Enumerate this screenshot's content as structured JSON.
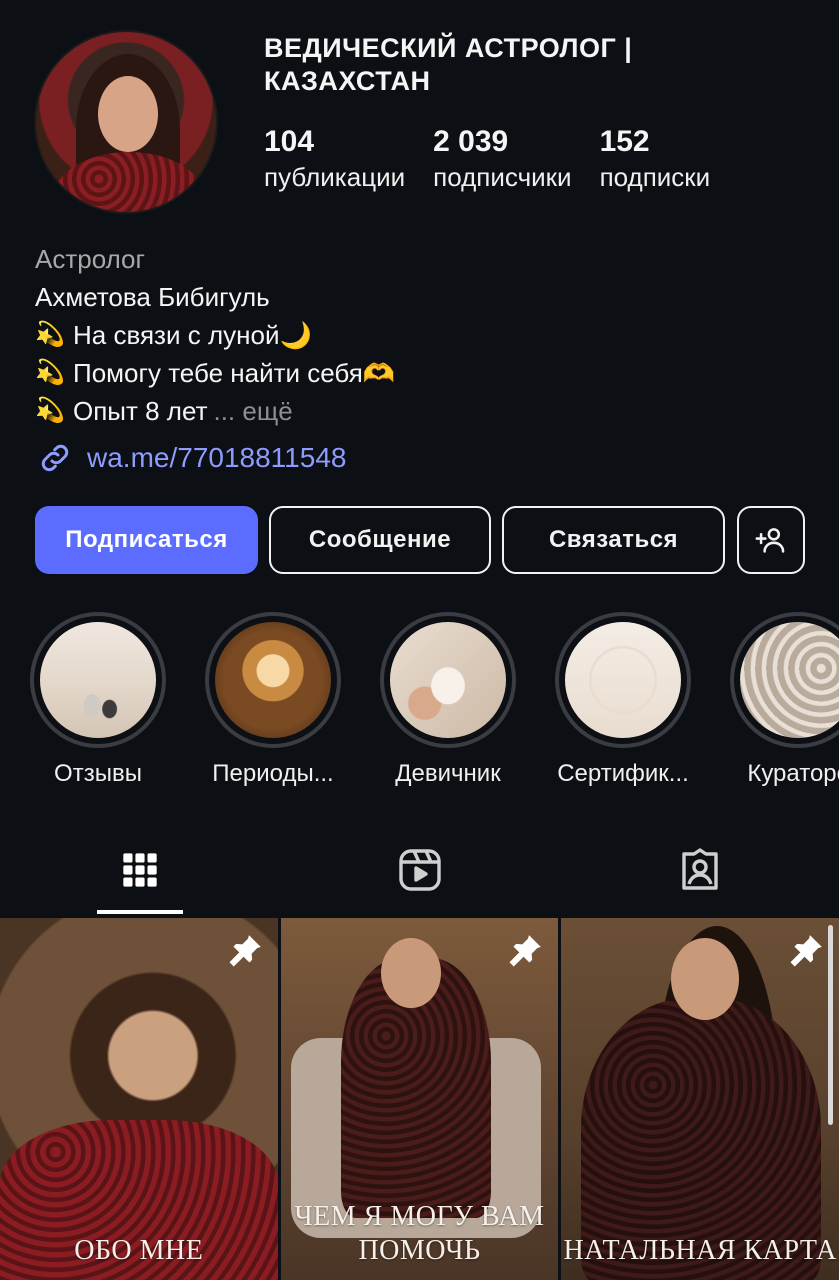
{
  "profile": {
    "title": "ВЕДИЧЕСКИЙ АСТРОЛОГ | КАЗАХСТАН",
    "stats": [
      {
        "num": "104",
        "label": "публикации"
      },
      {
        "num": "2 039",
        "label": "подписчики"
      },
      {
        "num": "152",
        "label": "подписки"
      }
    ],
    "category": "Астролог",
    "name": "Ахметова Бибигуль",
    "bio_lines": [
      {
        "emoji": "💫",
        "text": "На связи с луной🌙"
      },
      {
        "emoji": "💫",
        "text": "Помогу тебе найти себя🫶"
      },
      {
        "emoji": "💫",
        "text": "Опыт 8 лет"
      }
    ],
    "more_label": "... ещё",
    "link": "wa.me/77018811548"
  },
  "buttons": {
    "follow": "Подписаться",
    "message": "Сообщение",
    "contact": "Связаться",
    "add_person_icon": "add-person-icon"
  },
  "highlights": [
    {
      "label": "Отзывы",
      "icon": "zen-stones"
    },
    {
      "label": "Периоды...",
      "icon": "crystal-ball"
    },
    {
      "label": "Девичник",
      "icon": "cup"
    },
    {
      "label": "Сертифик...",
      "icon": "dry-flowers"
    },
    {
      "label": "Кураторс",
      "icon": "moon-phases-card"
    }
  ],
  "tabs": [
    "grid-icon",
    "reels-icon",
    "tagged-icon"
  ],
  "posts": [
    {
      "caption": "ОБО МНЕ",
      "pinned": true
    },
    {
      "caption": "ЧЕМ Я МОГУ ВАМ ПОМОЧЬ",
      "pinned": true
    },
    {
      "caption": "НАТАЛЬНАЯ КАРТА",
      "pinned": true
    }
  ],
  "colors": {
    "accent": "#5b6cff",
    "link": "#8e9bff",
    "background": "#0c0f14"
  }
}
